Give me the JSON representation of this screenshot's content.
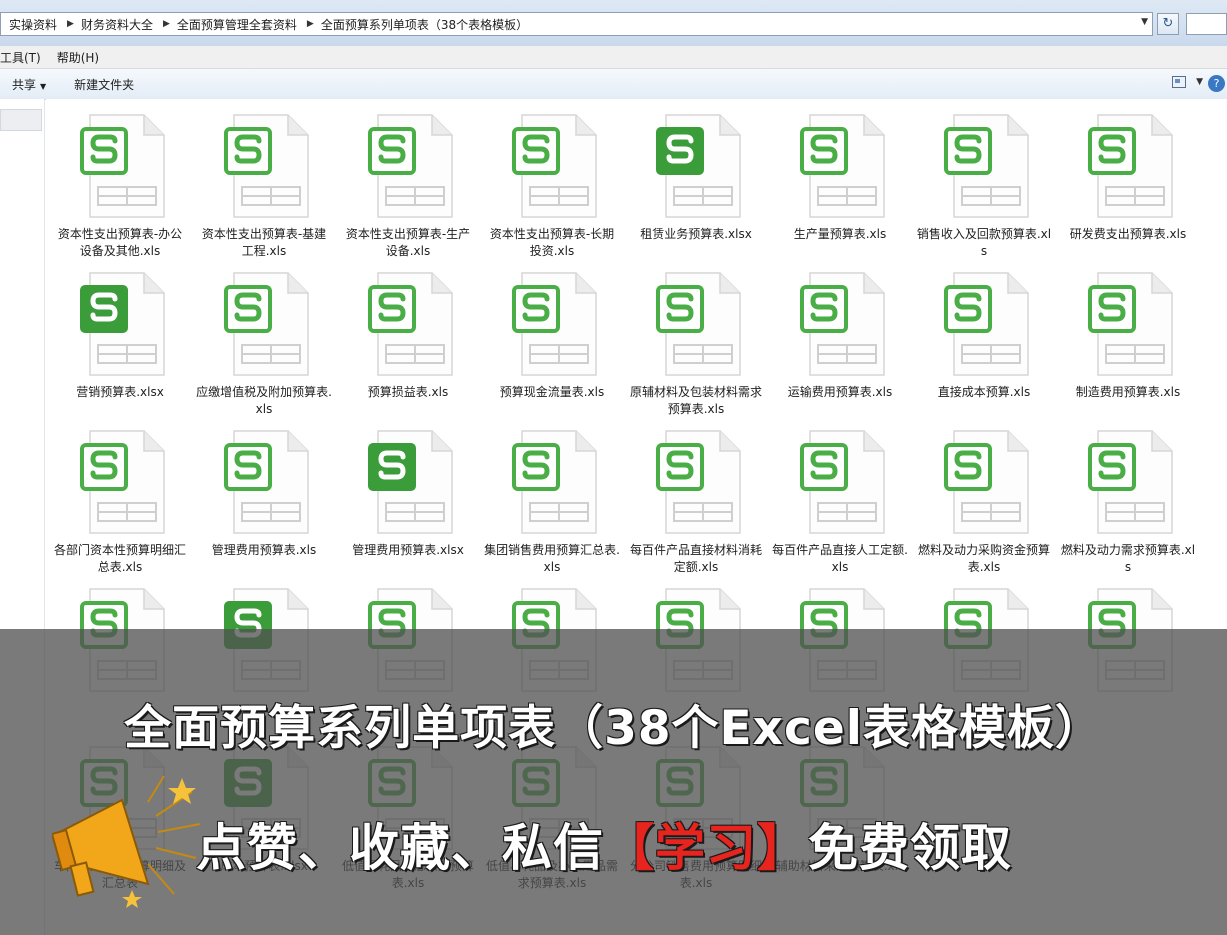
{
  "breadcrumb": [
    "实操资料",
    "财务资料大全",
    "全面预算管理全套资料",
    "全面预算系列单项表（38个表格模板）"
  ],
  "menu": [
    "工具(T)",
    "帮助(H)"
  ],
  "toolbar": {
    "share": "共享",
    "new_folder": "新建文件夹"
  },
  "colors": {
    "icon_green": "#4aae47",
    "icon_green_dark": "#3a9d3a"
  },
  "files": [
    {
      "name": "资本性支出预算表-办公设备及其他.xls",
      "type": "xls"
    },
    {
      "name": "资本性支出预算表-基建工程.xls",
      "type": "xls"
    },
    {
      "name": "资本性支出预算表-生产设备.xls",
      "type": "xls"
    },
    {
      "name": "资本性支出预算表-长期投资.xls",
      "type": "xls"
    },
    {
      "name": "租赁业务预算表.xlsx",
      "type": "xlsx"
    },
    {
      "name": "生产量预算表.xls",
      "type": "xls"
    },
    {
      "name": "销售收入及回款预算表.xls",
      "type": "xls"
    },
    {
      "name": "研发费支出预算表.xls",
      "type": "xls"
    },
    {
      "name": "营销预算表.xlsx",
      "type": "xlsx"
    },
    {
      "name": "应缴增值税及附加预算表.xls",
      "type": "xls"
    },
    {
      "name": "预算损益表.xls",
      "type": "xls"
    },
    {
      "name": "预算现金流量表.xls",
      "type": "xls"
    },
    {
      "name": "原辅材料及包装材料需求预算表.xls",
      "type": "xls"
    },
    {
      "name": "运输费用预算表.xls",
      "type": "xls"
    },
    {
      "name": "直接成本预算.xls",
      "type": "xls"
    },
    {
      "name": "制造费用预算表.xls",
      "type": "xls"
    },
    {
      "name": "各部门资本性预算明细汇总表.xls",
      "type": "xls"
    },
    {
      "name": "管理费用预算表.xls",
      "type": "xls"
    },
    {
      "name": "管理费用预算表.xlsx",
      "type": "xlsx"
    },
    {
      "name": "集团销售费用预算汇总表.xls",
      "type": "xls"
    },
    {
      "name": "每百件产品直接材料消耗定额.xls",
      "type": "xls"
    },
    {
      "name": "每百件产品直接人工定额.xls",
      "type": "xls"
    },
    {
      "name": "燃料及动力采购资金预算表.xls",
      "type": "xls"
    },
    {
      "name": "燃料及动力需求预算表.xls",
      "type": "xls"
    },
    {
      "name": "",
      "type": "xls"
    },
    {
      "name": "",
      "type": "xlsx"
    },
    {
      "name": "",
      "type": "xls"
    },
    {
      "name": "",
      "type": "xls"
    },
    {
      "name": "",
      "type": "xls"
    },
    {
      "name": "",
      "type": "xls"
    },
    {
      "name": "",
      "type": "xls"
    },
    {
      "name": "",
      "type": "xls"
    },
    {
      "name": "车间制造费用预算明细及汇总表",
      "type": "xls"
    },
    {
      "name": "成本预算表.xlsx",
      "type": "xlsx"
    },
    {
      "name": "低值易耗品汇总采购预算表.xls",
      "type": "xls"
    },
    {
      "name": "低值易耗品及办公用品需求预算表.xls",
      "type": "xls"
    },
    {
      "name": "分公司销售费用预算明细表.xls",
      "type": "xls"
    },
    {
      "name": "辅助材料采购预算表.xls",
      "type": "xls"
    }
  ],
  "overlay": {
    "title": "全面预算系列单项表（38个Excel表格模板）",
    "sub_before": "点赞、收藏、私信",
    "sub_highlight": "【学习】",
    "sub_after": "免费领取"
  }
}
